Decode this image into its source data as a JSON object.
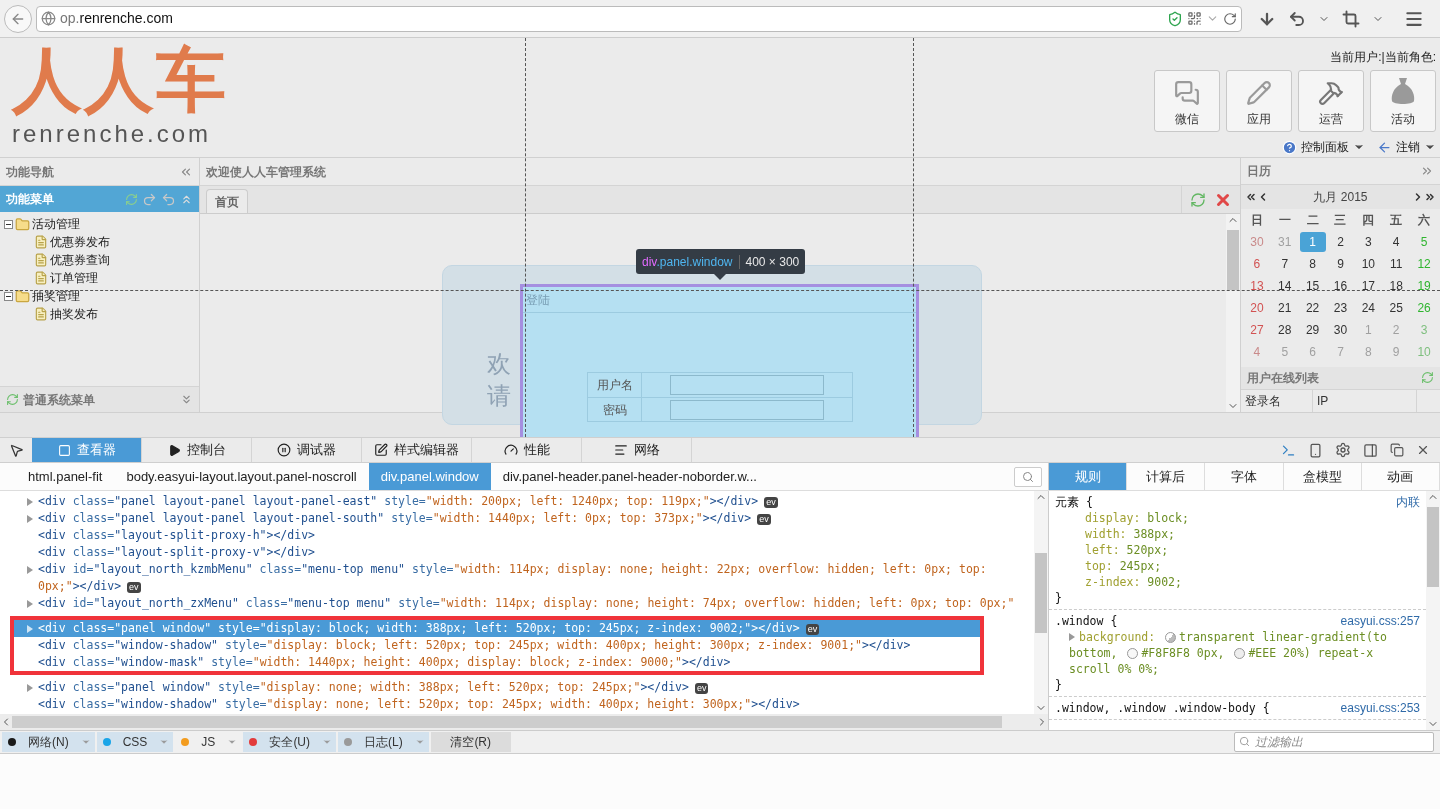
{
  "browser": {
    "url_prefix": "op.",
    "url_domain": "renrenche.com"
  },
  "header": {
    "logo": "人人车",
    "logo_sub": "renrenche.com",
    "user_info": "当前用户:|当前角色:",
    "buttons": [
      {
        "label": "微信"
      },
      {
        "label": "应用"
      },
      {
        "label": "运营"
      },
      {
        "label": "活动"
      }
    ],
    "links": [
      {
        "label": "控制面板"
      },
      {
        "label": "注销"
      }
    ]
  },
  "nav": {
    "title": "功能导航",
    "panels": [
      {
        "title": "功能菜单",
        "selected": true
      },
      {
        "title": "普通系统菜单",
        "selected": false
      }
    ],
    "tree": [
      {
        "label": "活动管理",
        "expanded": true,
        "children": [
          {
            "label": "优惠券发布"
          },
          {
            "label": "优惠券查询"
          },
          {
            "label": "订单管理"
          }
        ]
      },
      {
        "label": "抽奖管理",
        "expanded": true,
        "children": [
          {
            "label": "抽奖发布"
          }
        ]
      }
    ]
  },
  "center": {
    "title": "欢迎使人人车管理系统",
    "tabs": [
      {
        "label": "首页",
        "selected": true
      }
    ],
    "card_lines": [
      "欢",
      "请"
    ]
  },
  "login_window": {
    "title": "登陆",
    "fields": [
      {
        "label": "用户名"
      },
      {
        "label": "密码"
      }
    ]
  },
  "inspector_tooltip": {
    "tag": "div",
    "classes": ".panel.window",
    "size": "400 × 300"
  },
  "calendar": {
    "title": "日历",
    "month": "九月 2015",
    "weekdays": [
      "日",
      "一",
      "二",
      "三",
      "四",
      "五",
      "六"
    ],
    "weeks": [
      [
        {
          "label": "30",
          "in_month": false,
          "selected": false
        },
        {
          "label": "31",
          "in_month": false,
          "selected": false
        },
        {
          "label": "1",
          "in_month": true,
          "selected": true
        },
        {
          "label": "2",
          "in_month": true,
          "selected": false
        },
        {
          "label": "3",
          "in_month": true,
          "selected": false
        },
        {
          "label": "4",
          "in_month": true,
          "selected": false
        },
        {
          "label": "5",
          "in_month": true,
          "selected": false
        }
      ],
      [
        {
          "label": "6",
          "in_month": true,
          "selected": false
        },
        {
          "label": "7",
          "in_month": true,
          "selected": false
        },
        {
          "label": "8",
          "in_month": true,
          "selected": false
        },
        {
          "label": "9",
          "in_month": true,
          "selected": false
        },
        {
          "label": "10",
          "in_month": true,
          "selected": false
        },
        {
          "label": "11",
          "in_month": true,
          "selected": false
        },
        {
          "label": "12",
          "in_month": true,
          "selected": false
        }
      ],
      [
        {
          "label": "13",
          "in_month": true,
          "selected": false
        },
        {
          "label": "14",
          "in_month": true,
          "selected": false
        },
        {
          "label": "15",
          "in_month": true,
          "selected": false
        },
        {
          "label": "16",
          "in_month": true,
          "selected": false
        },
        {
          "label": "17",
          "in_month": true,
          "selected": false
        },
        {
          "label": "18",
          "in_month": true,
          "selected": false
        },
        {
          "label": "19",
          "in_month": true,
          "selected": false
        }
      ],
      [
        {
          "label": "20",
          "in_month": true,
          "selected": false
        },
        {
          "label": "21",
          "in_month": true,
          "selected": false
        },
        {
          "label": "22",
          "in_month": true,
          "selected": false
        },
        {
          "label": "23",
          "in_month": true,
          "selected": false
        },
        {
          "label": "24",
          "in_month": true,
          "selected": false
        },
        {
          "label": "25",
          "in_month": true,
          "selected": false
        },
        {
          "label": "26",
          "in_month": true,
          "selected": false
        }
      ],
      [
        {
          "label": "27",
          "in_month": true,
          "selected": false
        },
        {
          "label": "28",
          "in_month": true,
          "selected": false
        },
        {
          "label": "29",
          "in_month": true,
          "selected": false
        },
        {
          "label": "30",
          "in_month": true,
          "selected": false
        },
        {
          "label": "1",
          "in_month": false,
          "selected": false
        },
        {
          "label": "2",
          "in_month": false,
          "selected": false
        },
        {
          "label": "3",
          "in_month": false,
          "selected": false
        }
      ],
      [
        {
          "label": "4",
          "in_month": false,
          "selected": false
        },
        {
          "label": "5",
          "in_month": false,
          "selected": false
        },
        {
          "label": "6",
          "in_month": false,
          "selected": false
        },
        {
          "label": "7",
          "in_month": false,
          "selected": false
        },
        {
          "label": "8",
          "in_month": false,
          "selected": false
        },
        {
          "label": "9",
          "in_month": false,
          "selected": false
        },
        {
          "label": "10",
          "in_month": false,
          "selected": false
        }
      ]
    ]
  },
  "online_users": {
    "title": "用户在线列表",
    "columns": [
      "登录名",
      "IP"
    ]
  },
  "devtools": {
    "tabs": [
      {
        "label": "查看器",
        "selected": true
      },
      {
        "label": "控制台",
        "selected": false
      },
      {
        "label": "调试器",
        "selected": false
      },
      {
        "label": "样式编辑器",
        "selected": false
      },
      {
        "label": "性能",
        "selected": false
      },
      {
        "label": "网络",
        "selected": false
      }
    ],
    "breadcrumbs": [
      {
        "label": "html.panel-fit",
        "selected": false
      },
      {
        "label": "body.easyui-layout.layout.panel-noscroll",
        "selected": false
      },
      {
        "label": "div.panel.window",
        "selected": true
      },
      {
        "label": "div.panel-header.panel-header-noborder.w...",
        "selected": false
      }
    ],
    "lines": [
      {
        "code": "<div class=\"panel layout-panel layout-panel-east\" style=\"width: 200px; left: 1240px; top: 119px;\"></div>",
        "expandable": true,
        "selected": false,
        "badge": "ev"
      },
      {
        "code": "<div class=\"panel layout-panel layout-panel-south\" style=\"width: 1440px; left: 0px; top: 373px;\"></div>",
        "expandable": true,
        "selected": false,
        "badge": "ev"
      },
      {
        "code": "<div class=\"layout-split-proxy-h\"></div>",
        "expandable": false,
        "selected": false
      },
      {
        "code": "<div class=\"layout-split-proxy-v\"></div>",
        "expandable": false,
        "selected": false
      },
      {
        "code": "<div id=\"layout_north_kzmbMenu\" class=\"menu-top menu\" style=\"width: 114px; display: none; height: 22px; overflow: hidden; left: 0px; top: 0px;\"></div>",
        "expandable": true,
        "selected": false,
        "badge": "ev"
      },
      {
        "code": "<div id=\"layout_north_zxMenu\" class=\"menu-top menu\" style=\"width: 114px; display: none; height: 74px; overflow: hidden; left: 0px; top: 0px;\"",
        "expandable": true,
        "selected": false
      },
      {
        "code": "<div class=\"panel window\" style=\"display: block; width: 388px; left: 520px; top: 245px; z-index: 9002;\"></div>",
        "expandable": true,
        "selected": true,
        "badge": "ev",
        "framed": true
      },
      {
        "code": "<div class=\"window-shadow\" style=\"display: block; left: 520px; top: 245px; width: 400px; height: 300px; z-index: 9001;\"></div>",
        "expandable": false,
        "selected": false,
        "framed": true
      },
      {
        "code": "<div class=\"window-mask\" style=\"width: 1440px; height: 400px; display: block; z-index: 9000;\"></div>",
        "expandable": false,
        "selected": false,
        "framed": true
      },
      {
        "code": "<div class=\"panel window\" style=\"display: none; width: 388px; left: 520px; top: 245px;\"></div>",
        "expandable": true,
        "selected": false,
        "badge": "ev"
      },
      {
        "code": "<div class=\"window-shadow\" style=\"display: none; left: 520px; top: 245px; width: 400px; height: 300px;\"></div>",
        "expandable": false,
        "selected": false
      }
    ],
    "side_tabs": [
      {
        "label": "规则",
        "selected": true
      },
      {
        "label": "计算后",
        "selected": false
      },
      {
        "label": "字体",
        "selected": false
      },
      {
        "label": "盒模型",
        "selected": false
      },
      {
        "label": "动画",
        "selected": false
      }
    ],
    "rules": [
      {
        "selector": "元素 {",
        "source": "内联",
        "declarations": [
          {
            "property": "display:",
            "value": "block;"
          },
          {
            "property": "width:",
            "value": "388px;"
          },
          {
            "property": "left:",
            "value": "520px;"
          },
          {
            "property": "top:",
            "value": "245px;"
          },
          {
            "property": "z-index:",
            "value": "9002;"
          }
        ],
        "close": "}"
      },
      {
        "selector": ".window {",
        "source": "easyui.css:257",
        "declarations": [
          {
            "property": "background:",
            "expandable": true,
            "parts": [
              {
                "kind": "gradient",
                "text": "transparent linear-gradient(to bottom,"
              },
              {
                "kind": "color",
                "color": "#f8f8f8",
                "text": "#F8F8F8 0px,"
              },
              {
                "kind": "color",
                "color": "#eeeeee",
                "text": "#EEE 20%) repeat-x scroll 0% 0%;"
              }
            ]
          }
        ],
        "close": "}"
      },
      {
        "selector": ".window, .window .window-body {",
        "source": "easyui.css:253"
      }
    ],
    "console_filters": [
      {
        "label": "网络(N)",
        "color": "#1a1a1a",
        "selected": true
      },
      {
        "label": "CSS",
        "color": "#1aa5e8",
        "selected": true
      },
      {
        "label": "JS",
        "color": "#f39c1f",
        "selected": false
      },
      {
        "label": "安全(U)",
        "color": "#e23b3b",
        "selected": true
      },
      {
        "label": "日志(L)",
        "color": "#9a9a9a",
        "selected": true
      }
    ],
    "clear_button": "清空(R)",
    "filter_placeholder": "过滤输出"
  }
}
